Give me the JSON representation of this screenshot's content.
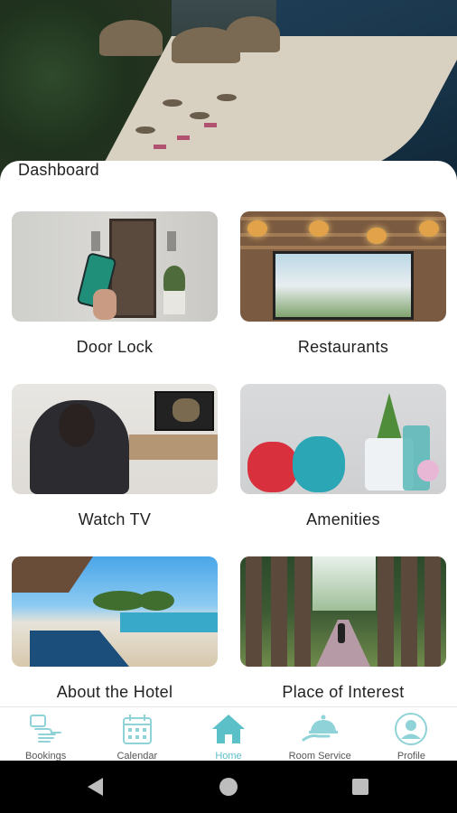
{
  "dashboard": {
    "title": "Dashboard"
  },
  "cards": [
    {
      "label": "Door Lock"
    },
    {
      "label": "Restaurants"
    },
    {
      "label": "Watch TV"
    },
    {
      "label": "Amenities"
    },
    {
      "label": "About the Hotel"
    },
    {
      "label": "Place of Interest"
    }
  ],
  "nav": {
    "items": [
      {
        "label": "Bookings",
        "icon": "hand-card-icon"
      },
      {
        "label": "Calendar",
        "icon": "calendar-icon"
      },
      {
        "label": "Home",
        "icon": "home-icon",
        "active": true
      },
      {
        "label": "Room Service",
        "icon": "cloche-icon"
      },
      {
        "label": "Profile",
        "icon": "profile-icon"
      }
    ],
    "accent": "#5cc0c8",
    "inactive": "#8fd3d8"
  }
}
